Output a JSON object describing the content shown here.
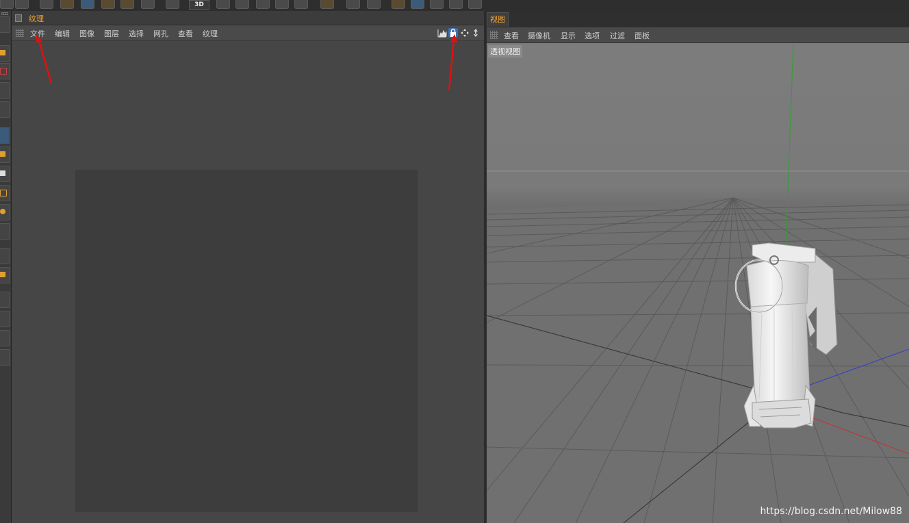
{
  "texture_panel": {
    "title": "纹理",
    "menu": [
      "文件",
      "编辑",
      "图像",
      "图层",
      "选择",
      "网孔",
      "查看",
      "纹理"
    ],
    "icons": [
      "histogram-icon",
      "lock-icon",
      "move-icon",
      "pan-vertical-icon"
    ]
  },
  "viewport_panel": {
    "tab": "视图",
    "menu": [
      "查看",
      "摄像机",
      "显示",
      "选项",
      "过滤",
      "面板"
    ],
    "view_label": "透视视图"
  },
  "toolbar": {
    "mode_3d": "3D"
  },
  "watermark": "https://blog.csdn.net/Milow88",
  "colors": {
    "accent_orange": "#f0a030",
    "annotation_red": "#e01010",
    "axis_x": "#c83030",
    "axis_y": "#30a030",
    "axis_z": "#3040c8"
  }
}
